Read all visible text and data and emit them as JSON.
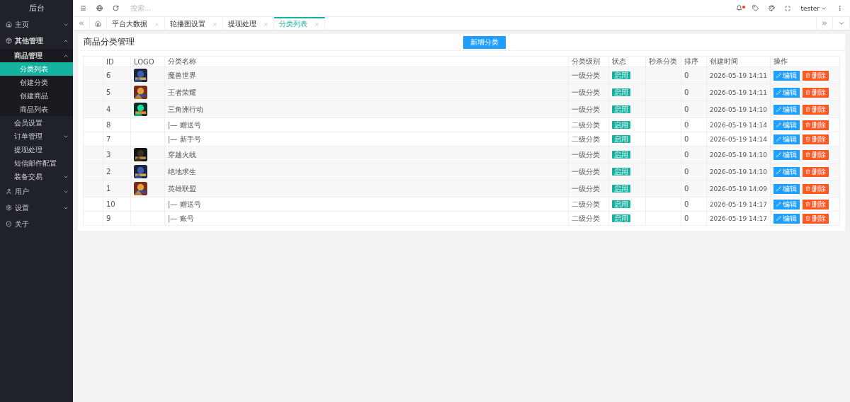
{
  "sidebar": {
    "title": "后台",
    "items": [
      {
        "label": "主页",
        "expanded": false,
        "selected": false
      },
      {
        "label": "其他管理",
        "expanded": true,
        "selected": false,
        "children": [
          {
            "label": "商品管理",
            "expanded": true,
            "selected": false,
            "children": [
              {
                "label": "分类列表",
                "selected": true
              },
              {
                "label": "创建分类",
                "selected": false
              },
              {
                "label": "创建商品",
                "selected": false
              },
              {
                "label": "商品列表",
                "selected": false
              }
            ]
          },
          {
            "label": "会员设置",
            "selected": false
          },
          {
            "label": "订单管理",
            "expanded": false,
            "selected": false
          },
          {
            "label": "提现处理",
            "selected": false
          },
          {
            "label": "短信邮件配置",
            "selected": false
          },
          {
            "label": "装备交易",
            "expanded": false,
            "selected": false
          }
        ]
      },
      {
        "label": "用户",
        "expanded": false,
        "selected": false
      },
      {
        "label": "设置",
        "expanded": false,
        "selected": false
      },
      {
        "label": "关于",
        "selected": false
      }
    ]
  },
  "topbar": {
    "search": {
      "placeholder": "搜索..."
    },
    "notification": true,
    "user": "tester"
  },
  "tabs": [
    {
      "label": "平台大数据",
      "selected": false
    },
    {
      "label": "轮播图设置",
      "selected": false
    },
    {
      "label": "提现处理",
      "selected": false
    },
    {
      "label": "分类列表",
      "selected": true
    }
  ],
  "page": {
    "title": "商品分类管理",
    "add_button": "新增分类"
  },
  "table": {
    "columns": [
      "ID",
      "LOGO",
      "分类名称",
      "分类级别",
      "状态",
      "秒杀分类",
      "排序",
      "创建时间",
      "操作"
    ],
    "rows": [
      {
        "id": "6",
        "name": "魔兽世界",
        "level": "一级分类",
        "status": "启用",
        "sort": "0",
        "created": "2026-05-19 14:11",
        "actions": [
          "编辑",
          "删除"
        ]
      },
      {
        "id": "5",
        "name": "王者荣耀",
        "level": "一级分类",
        "status": "启用",
        "sort": "0",
        "created": "2026-05-19 14:11",
        "actions": [
          "编辑",
          "删除"
        ]
      },
      {
        "id": "4",
        "name": "三角洲行动",
        "level": "一级分类",
        "status": "启用",
        "sort": "0",
        "created": "2026-05-19 14:10",
        "actions": [
          "编辑",
          "删除"
        ]
      },
      {
        "id": "8",
        "name": "|— 赠送号",
        "level": "二级分类",
        "status": "启用",
        "sort": "0",
        "created": "2026-05-19 14:14",
        "actions": [
          "编辑",
          "删除"
        ]
      },
      {
        "id": "7",
        "name": "|— 新手号",
        "level": "二级分类",
        "status": "启用",
        "sort": "0",
        "created": "2026-05-19 14:14",
        "actions": [
          "编辑",
          "删除"
        ]
      },
      {
        "id": "3",
        "name": "穿越火线",
        "level": "一级分类",
        "status": "启用",
        "sort": "0",
        "created": "2026-05-19 14:10",
        "actions": [
          "编辑",
          "删除"
        ]
      },
      {
        "id": "2",
        "name": "绝地求生",
        "level": "一级分类",
        "status": "启用",
        "sort": "0",
        "created": "2026-05-19 14:10",
        "actions": [
          "编辑",
          "删除"
        ]
      },
      {
        "id": "1",
        "name": "英雄联盟",
        "level": "一级分类",
        "status": "启用",
        "sort": "0",
        "created": "2026-05-19 14:09",
        "actions": [
          "编辑",
          "删除"
        ]
      },
      {
        "id": "10",
        "name": "|— 赠送号",
        "level": "二级分类",
        "status": "启用",
        "sort": "0",
        "created": "2026-05-19 14:17",
        "actions": [
          "编辑",
          "删除"
        ]
      },
      {
        "id": "9",
        "name": "|— 账号",
        "level": "二级分类",
        "status": "启用",
        "sort": "0",
        "created": "2026-05-19 14:17",
        "actions": [
          "编辑",
          "删除"
        ]
      }
    ]
  }
}
